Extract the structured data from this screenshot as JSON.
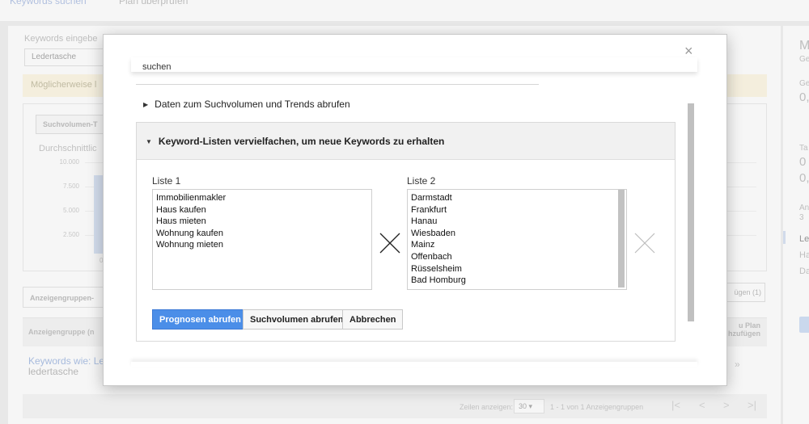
{
  "topnav": {
    "tab1": "Keywords suchen",
    "tab2": "Plan überprüfen"
  },
  "background": {
    "keywords_label": "Keywords eingebe",
    "keywords_value": "Ledertasche",
    "warning": "Möglicherweise l",
    "sv_tab": "Suchvolumen-T",
    "chart_title": "Durchschnittlic",
    "y_ticks": [
      "10.000",
      "7.500",
      "5.000",
      "2.500",
      "0"
    ],
    "adgroup_tab": "Anzeigengruppen-",
    "adgroup_col": "Anzeigengruppe (n",
    "adgroup_row_link": "Keywords wie: Le",
    "adgroup_row_sub": "ledertasche",
    "add_button": "ügen (1)",
    "plan_col": "u Plan\nhzufügen",
    "row_chev": "»",
    "pager_label": "Zeilen anzeigen:",
    "pager_value": "30",
    "pager_range": "1 - 1 von 1 Anzeigengruppen",
    "pager_nav": [
      "|<",
      "<",
      ">",
      ">|"
    ],
    "right_panel": [
      "M",
      "Ge",
      "Ge",
      "0,",
      "Ta",
      "0",
      "0,",
      "An",
      "3",
      "Le",
      "Ha",
      "Da"
    ]
  },
  "modal": {
    "close_glyph": "×",
    "search_text": "suchen",
    "sv_trends": "Daten zum Suchvolumen und Trends abrufen",
    "multiply_header": "Keyword-Listen vervielfachen, um neue Keywords zu erhalten",
    "list1_label": "Liste 1",
    "list1": [
      "Immobilienmakler",
      "Haus kaufen",
      "Haus mieten",
      "Wohnung kaufen",
      "Wohnung mieten"
    ],
    "list2_label": "Liste 2",
    "list2": [
      "Darmstadt",
      "Frankfurt",
      "Hanau",
      "Wiesbaden",
      "Mainz",
      "Offenbach",
      "Rüsselsheim",
      "Bad Homburg"
    ],
    "btn_forecast": "Prognosen abrufen",
    "btn_volume": "Suchvolumen abrufen",
    "btn_cancel": "Abbrechen"
  },
  "colors": {
    "primary_button": "#4b8ee8",
    "header_bg": "#f1f1f1"
  }
}
